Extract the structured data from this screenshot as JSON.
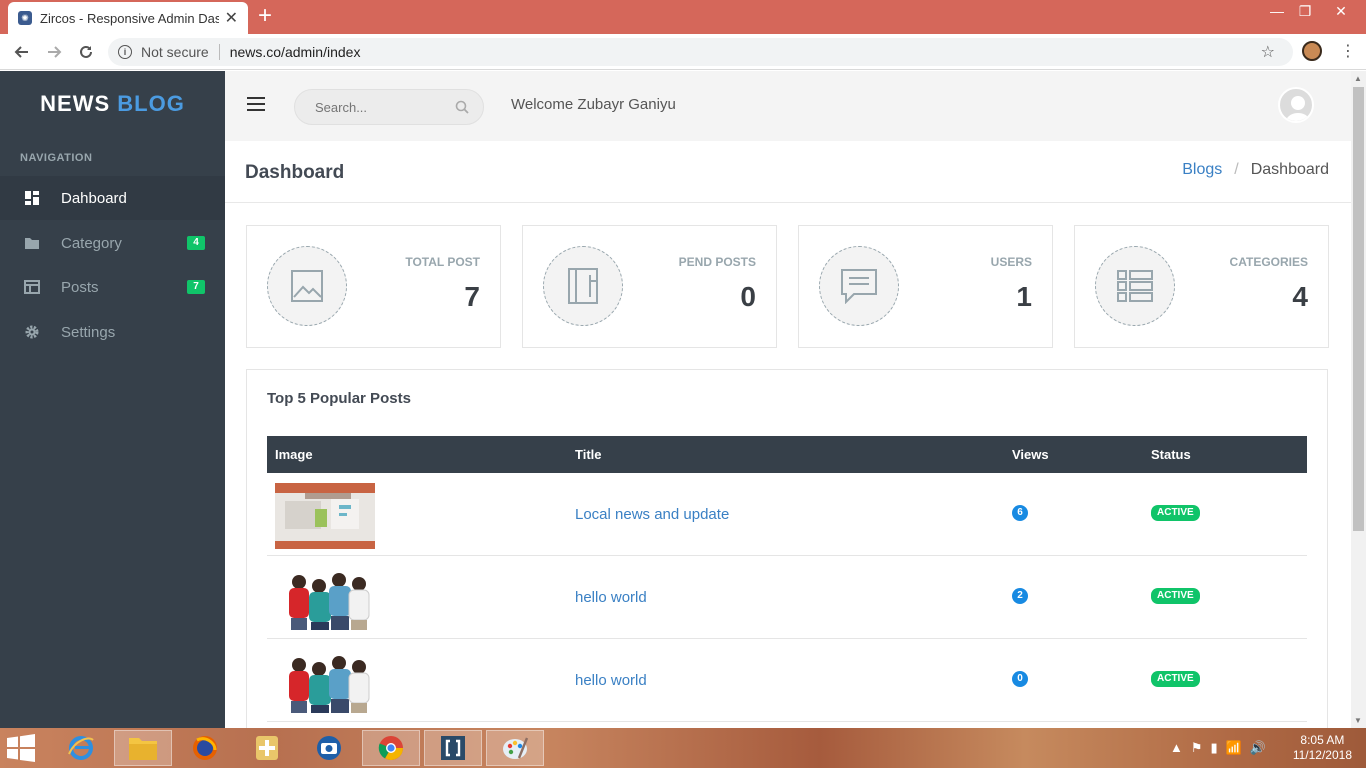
{
  "browser": {
    "tab_title": "Zircos - Responsive Admin Dashb",
    "security_label": "Not secure",
    "url": "news.co/admin/index"
  },
  "sidebar": {
    "logo_part1": "NEWS",
    "logo_part2": "BLOG",
    "nav_title": "NAVIGATION",
    "items": [
      {
        "label": "Dahboard",
        "icon": "dashboard-icon",
        "active": true
      },
      {
        "label": "Category",
        "icon": "folder-icon",
        "count": "4"
      },
      {
        "label": "Posts",
        "icon": "posts-icon",
        "count": "7"
      },
      {
        "label": "Settings",
        "icon": "gear-icon"
      }
    ]
  },
  "topbar": {
    "search_placeholder": "Search...",
    "welcome": "Welcome Zubayr Ganiyu"
  },
  "page": {
    "title": "Dashboard",
    "breadcrumb": [
      "Blogs",
      "Dashboard"
    ]
  },
  "stats": [
    {
      "label": "TOTAL POST",
      "value": "7",
      "icon": "image-icon"
    },
    {
      "label": "PEND POSTS",
      "value": "0",
      "icon": "notebook-icon"
    },
    {
      "label": "USERS",
      "value": "1",
      "icon": "chat-icon"
    },
    {
      "label": "CATEGORIES",
      "value": "4",
      "icon": "list-icon"
    }
  ],
  "popular": {
    "title": "Top 5 Popular Posts",
    "columns": [
      "Image",
      "Title",
      "Views",
      "Status"
    ],
    "rows": [
      {
        "title": "Local news and update",
        "views": "6",
        "status": "ACTIVE"
      },
      {
        "title": "hello world",
        "views": "2",
        "status": "ACTIVE"
      },
      {
        "title": "hello world",
        "views": "0",
        "status": "ACTIVE"
      }
    ]
  },
  "taskbar": {
    "time": "8:05 AM",
    "date": "11/12/2018"
  },
  "colors": {
    "sidebar_bg": "#36404a",
    "accent_blue": "#4b9be1",
    "badge_green": "#10c469",
    "views_blue": "#188ae2",
    "browser_frame": "#d5675a"
  }
}
